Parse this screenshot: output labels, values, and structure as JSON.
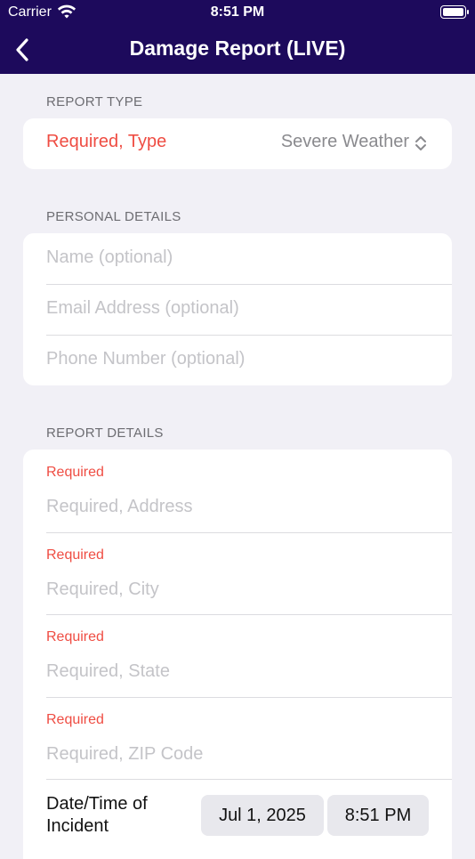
{
  "status_bar": {
    "carrier": "Carrier",
    "time": "8:51 PM"
  },
  "nav": {
    "title": "Damage Report (LIVE)"
  },
  "report_type": {
    "header": "REPORT TYPE",
    "label": "Required, Type",
    "value": "Severe Weather"
  },
  "personal_details": {
    "header": "PERSONAL DETAILS",
    "fields": [
      {
        "placeholder": "Name (optional)"
      },
      {
        "placeholder": "Email Address (optional)"
      },
      {
        "placeholder": "Phone Number (optional)"
      }
    ]
  },
  "report_details": {
    "header": "REPORT DETAILS",
    "fields": [
      {
        "label": "Required",
        "placeholder": "Required, Address"
      },
      {
        "label": "Required",
        "placeholder": "Required, City"
      },
      {
        "label": "Required",
        "placeholder": "Required, State"
      },
      {
        "label": "Required",
        "placeholder": "Required, ZIP Code"
      }
    ],
    "datetime": {
      "label": "Date/Time of Incident",
      "date": "Jul 1, 2025",
      "time": "8:51 PM"
    }
  },
  "colors": {
    "nav_bg": "#1d0a5c",
    "required": "#ef4d43",
    "placeholder": "#c4c4c8",
    "background": "#f1f0f6"
  }
}
